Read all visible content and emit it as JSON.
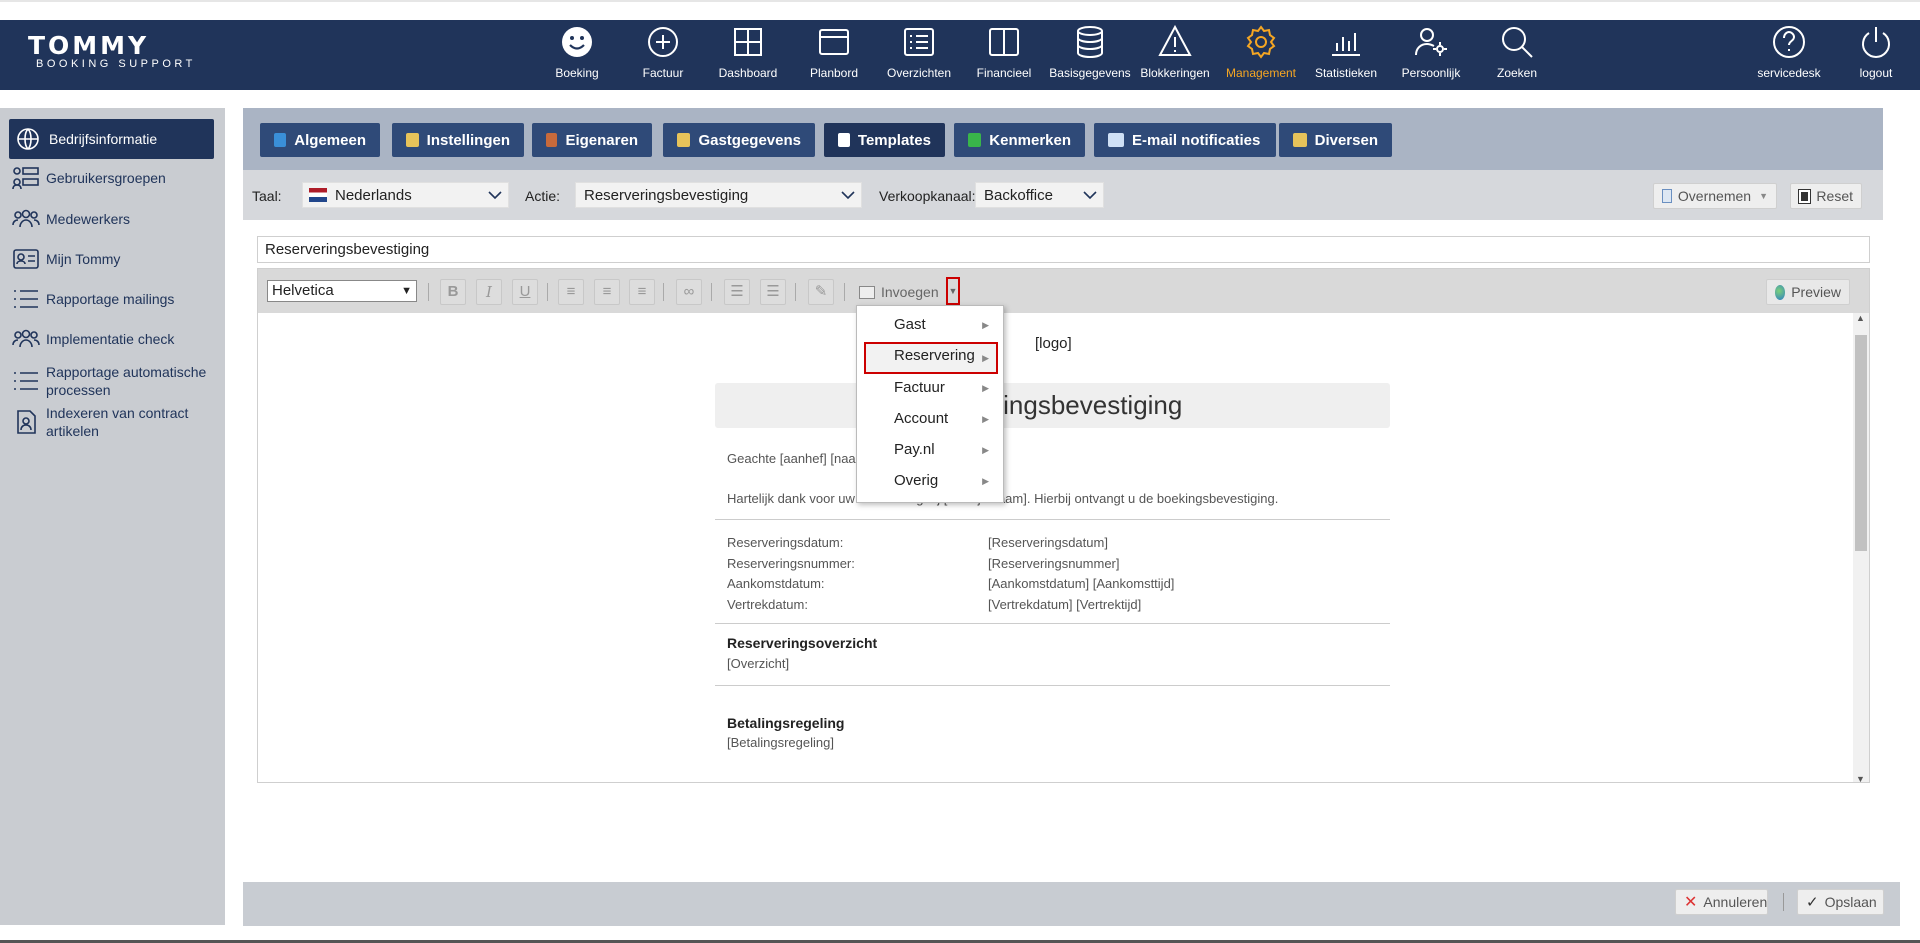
{
  "nav": {
    "logo_main": "TOMMY",
    "logo_sub": "BOOKING SUPPORT",
    "items": [
      {
        "label": "Boeking",
        "icon": "smiley-icon"
      },
      {
        "label": "Factuur",
        "icon": "plus-circle-icon"
      },
      {
        "label": "Dashboard",
        "icon": "grid-icon"
      },
      {
        "label": "Planbord",
        "icon": "window-icon"
      },
      {
        "label": "Overzichten",
        "icon": "list-icon"
      },
      {
        "label": "Financieel",
        "icon": "book-icon"
      },
      {
        "label": "Basisgegevens",
        "icon": "database-icon"
      },
      {
        "label": "Blokkeringen",
        "icon": "warning-icon"
      },
      {
        "label": "Management",
        "icon": "gear-icon",
        "active": true
      },
      {
        "label": "Statistieken",
        "icon": "bar-chart-icon"
      },
      {
        "label": "Persoonlijk",
        "icon": "user-gear-icon"
      },
      {
        "label": "Zoeken",
        "icon": "search-icon"
      }
    ],
    "right": [
      {
        "label": "servicedesk",
        "icon": "help-icon"
      },
      {
        "label": "logout",
        "icon": "power-icon"
      }
    ]
  },
  "sidebar": {
    "items": [
      {
        "label": "Bedrijfsinformatie",
        "icon": "globe-icon",
        "active": true
      },
      {
        "label": "Gebruikersgroepen",
        "icon": "groups-list-icon"
      },
      {
        "label": "Medewerkers",
        "icon": "people-icon"
      },
      {
        "label": "Mijn Tommy",
        "icon": "id-card-icon"
      },
      {
        "label": "Rapportage mailings",
        "icon": "list-icon"
      },
      {
        "label": "Implementatie check",
        "icon": "people-check-icon"
      },
      {
        "label": "Rapportage automatische processen",
        "icon": "list-icon"
      },
      {
        "label": "Indexeren van contract artikelen",
        "icon": "document-user-icon"
      }
    ]
  },
  "tabs": [
    {
      "label": "Algemeen",
      "icon_color": "#3a8fd8"
    },
    {
      "label": "Instellingen",
      "icon_color": "#e7c35a"
    },
    {
      "label": "Eigenaren",
      "icon_color": "#c86a3b"
    },
    {
      "label": "Gastgegevens",
      "icon_color": "#e7c35a"
    },
    {
      "label": "Templates",
      "icon_color": "#ffffff",
      "active": true
    },
    {
      "label": "Kenmerken",
      "icon_color": "#39b54a"
    },
    {
      "label": "E-mail notificaties",
      "icon_color": "#cfe0f5"
    },
    {
      "label": "Diversen",
      "icon_color": "#e7c35a"
    }
  ],
  "options": {
    "taal_label": "Taal:",
    "taal_value": "Nederlands",
    "actie_label": "Actie:",
    "actie_value": "Reserveringsbevestiging",
    "kanaal_label": "Verkoopkanaal:",
    "kanaal_value": "Backoffice",
    "overnemen": "Overnemen",
    "reset": "Reset"
  },
  "subject": "Reserveringsbevestiging",
  "toolbar": {
    "font": "Helvetica",
    "insert": "Invoegen",
    "preview": "Preview"
  },
  "dropdown": {
    "items": [
      "Gast",
      "Reservering",
      "Factuur",
      "Account",
      "Pay.nl",
      "Overig"
    ],
    "highlighted": "Reservering"
  },
  "document": {
    "logo": "[logo]",
    "heading": "eringsbevestiging",
    "greeting": "Geachte [aanhef] [naa",
    "intro": "Hartelijk dank voor uw reservering bij [Bedrijfsnaam]. Hierbij ontvangt u de boekingsbevestiging.",
    "fields": [
      {
        "label": "Reserveringsdatum:",
        "value": "[Reserveringsdatum]"
      },
      {
        "label": "Reserveringsnummer:",
        "value": "[Reserveringsnummer]"
      },
      {
        "label": "Aankomstdatum:",
        "value": "[Aankomstdatum] [Aankomsttijd]"
      },
      {
        "label": "Vertrekdatum:",
        "value": "[Vertrekdatum] [Vertrektijd]"
      }
    ],
    "overview_title": "Reserveringsoverzicht",
    "overview_value": "[Overzicht]",
    "payment_title": "Betalingsregeling",
    "payment_value": "[Betalingsregeling]"
  },
  "footer": {
    "cancel": "Annuleren",
    "save": "Opslaan"
  }
}
